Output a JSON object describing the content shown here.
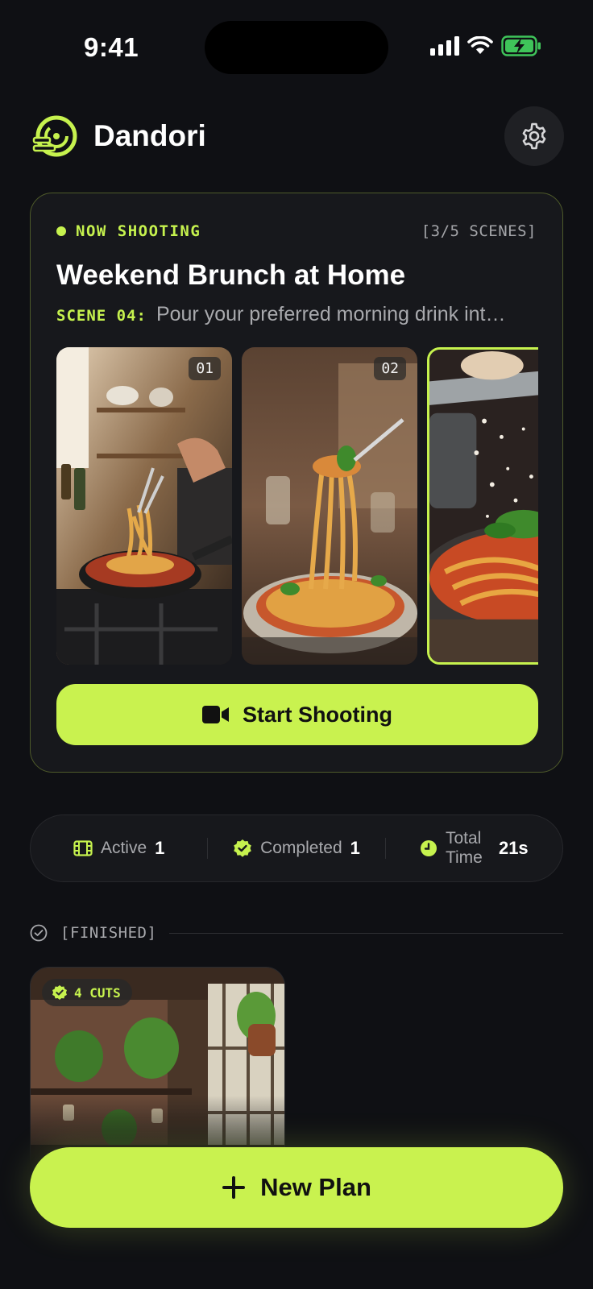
{
  "status_bar": {
    "time": "9:41"
  },
  "app": {
    "name": "Dandori"
  },
  "current_plan": {
    "badge": "NOW SHOOTING",
    "scene_count": "[3/5 SCENES]",
    "title": "Weekend Brunch at Home",
    "scene_label": "SCENE 04:",
    "scene_text": "Pour your preferred morning drink int…",
    "thumbnails": [
      {
        "number": "01"
      },
      {
        "number": "02"
      }
    ],
    "start_button": "Start Shooting"
  },
  "stats": {
    "active_label": "Active",
    "active_value": "1",
    "completed_label": "Completed",
    "completed_value": "1",
    "total_label": "Total Time",
    "total_value": "21s"
  },
  "finished": {
    "header": "[FINISHED]",
    "cards": [
      {
        "cuts": "4 CUTS"
      }
    ]
  },
  "new_plan_button": "New Plan",
  "colors": {
    "accent": "#c9f24f",
    "background": "#0f1014",
    "card": "#17181c"
  }
}
